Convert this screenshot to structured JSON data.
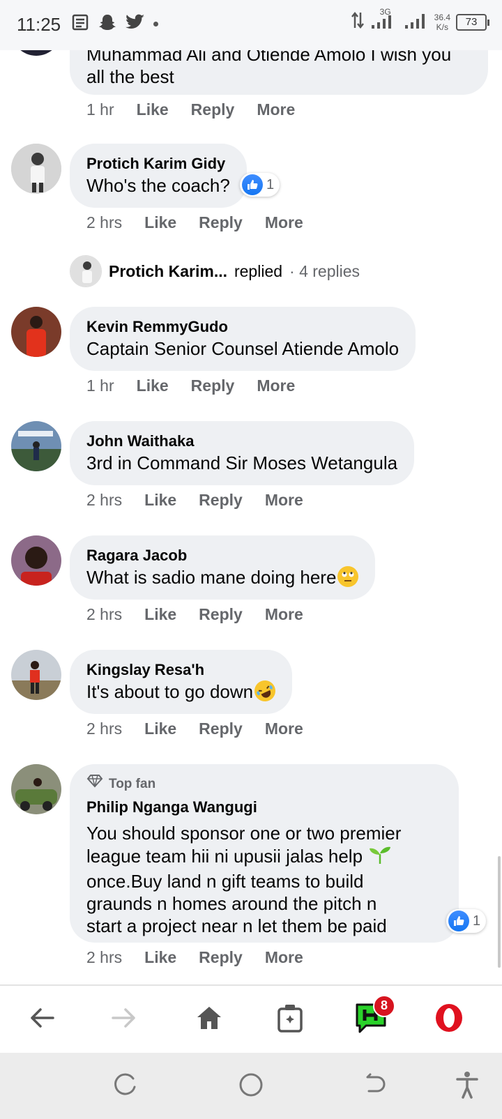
{
  "status_bar": {
    "time": "11:25",
    "network": "3G",
    "speed_value": "36.4",
    "speed_unit": "K/s",
    "battery": "73"
  },
  "comments": [
    {
      "text": "Muhammad Ali and Otiende Amolo I wish you all the best",
      "time": "1 hr"
    },
    {
      "author": "Protich Karim Gidy",
      "text": "Who's the coach?",
      "reaction_count": "1",
      "time": "2 hrs"
    },
    {
      "author": "Kevin RemmyGudo",
      "text": "Captain Senior Counsel Atiende Amolo",
      "time": "1 hr"
    },
    {
      "author": "John Waithaka",
      "text": "3rd in Command Sir Moses Wetangula",
      "time": "2 hrs"
    },
    {
      "author": "Ragara Jacob",
      "text": "What is sadio mane doing here",
      "time": "2 hrs"
    },
    {
      "author": "Kingslay Resa'h",
      "text": "It's about to go down",
      "time": "2 hrs"
    },
    {
      "badge": "Top fan",
      "author": "Philip Nganga Wangugi",
      "text_lines": [
        "You should sponsor one or two premier",
        "league team hii ni upusii jalas help",
        "once.Buy land n gift teams to build",
        "graunds n homes around the pitch n",
        "start a project near n let them be paid"
      ],
      "reaction_count": "1",
      "time": "2 hrs"
    }
  ],
  "actions": {
    "like": "Like",
    "reply": "Reply",
    "more": "More"
  },
  "replies_summary": {
    "author": "Protich Karim...",
    "verb": "replied",
    "count": "· 4 replies"
  },
  "browser_bar": {
    "hype_badge": "8"
  },
  "colors": {
    "bubble": "#eef0f3",
    "meta_text": "#65676b",
    "like_blue": "#1677f2",
    "badge_red": "#d7141f",
    "opera_red": "#e0111f",
    "hype_green": "#2ad22a"
  }
}
